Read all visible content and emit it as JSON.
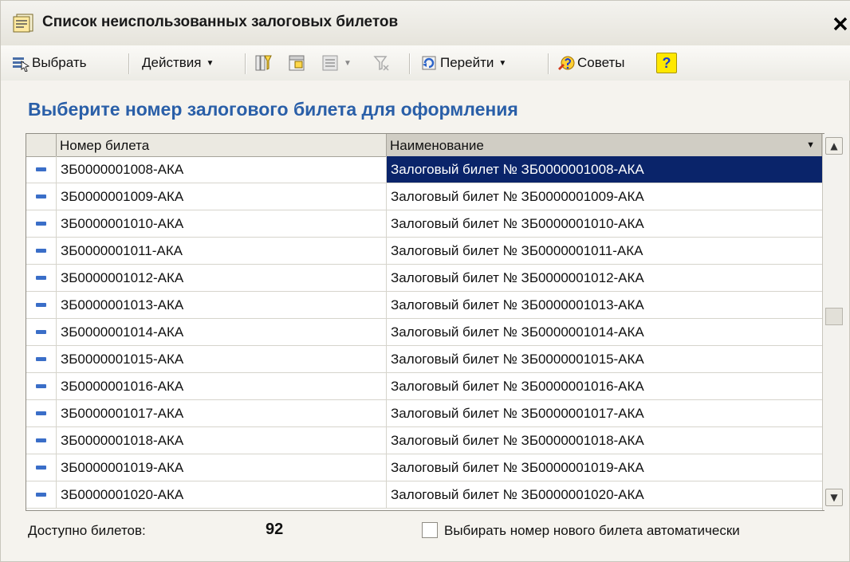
{
  "window": {
    "title": "Список неиспользованных залоговых билетов",
    "close_glyph": "✕"
  },
  "toolbar": {
    "select_label": "Выбрать",
    "actions_label": "Действия",
    "goto_label": "Перейти",
    "tips_label": "Советы",
    "help_label": "?"
  },
  "heading": "Выберите номер залогового билета для оформления",
  "table": {
    "columns": [
      "Номер билета",
      "Наименование"
    ],
    "rows": [
      {
        "number": "ЗБ0000001008-АКА",
        "name": "Залоговый билет № ЗБ0000001008-АКА"
      },
      {
        "number": "ЗБ0000001009-АКА",
        "name": "Залоговый билет № ЗБ0000001009-АКА"
      },
      {
        "number": "ЗБ0000001010-АКА",
        "name": "Залоговый билет № ЗБ0000001010-АКА"
      },
      {
        "number": "ЗБ0000001011-АКА",
        "name": "Залоговый билет № ЗБ0000001011-АКА"
      },
      {
        "number": "ЗБ0000001012-АКА",
        "name": "Залоговый билет № ЗБ0000001012-АКА"
      },
      {
        "number": "ЗБ0000001013-АКА",
        "name": "Залоговый билет № ЗБ0000001013-АКА"
      },
      {
        "number": "ЗБ0000001014-АКА",
        "name": "Залоговый билет № ЗБ0000001014-АКА"
      },
      {
        "number": "ЗБ0000001015-АКА",
        "name": "Залоговый билет № ЗБ0000001015-АКА"
      },
      {
        "number": "ЗБ0000001016-АКА",
        "name": "Залоговый билет № ЗБ0000001016-АКА"
      },
      {
        "number": "ЗБ0000001017-АКА",
        "name": "Залоговый билет № ЗБ0000001017-АКА"
      },
      {
        "number": "ЗБ0000001018-АКА",
        "name": "Залоговый билет № ЗБ0000001018-АКА"
      },
      {
        "number": "ЗБ0000001019-АКА",
        "name": "Залоговый билет № ЗБ0000001019-АКА"
      },
      {
        "number": "ЗБ0000001020-АКА",
        "name": "Залоговый билет № ЗБ0000001020-АКА"
      }
    ]
  },
  "footer": {
    "available_label": "Доступно билетов:",
    "available_count": "92",
    "auto_select_label": "Выбирать номер нового билета автоматически",
    "auto_select_checked": false
  },
  "icons": {
    "title": "document-list-icon",
    "select": "select-arrow-icon",
    "filter": "filter-icon",
    "filter_set": "filter-set-icon",
    "hierarchy": "hierarchy-icon",
    "filter_clear": "filter-clear-icon",
    "goto": "goto-icon",
    "tips": "tips-icon"
  },
  "colors": {
    "heading": "#2a5fa8",
    "selection": "#0a246a",
    "row_marker": "#3a6ec8",
    "help_button": "#ffe800"
  }
}
